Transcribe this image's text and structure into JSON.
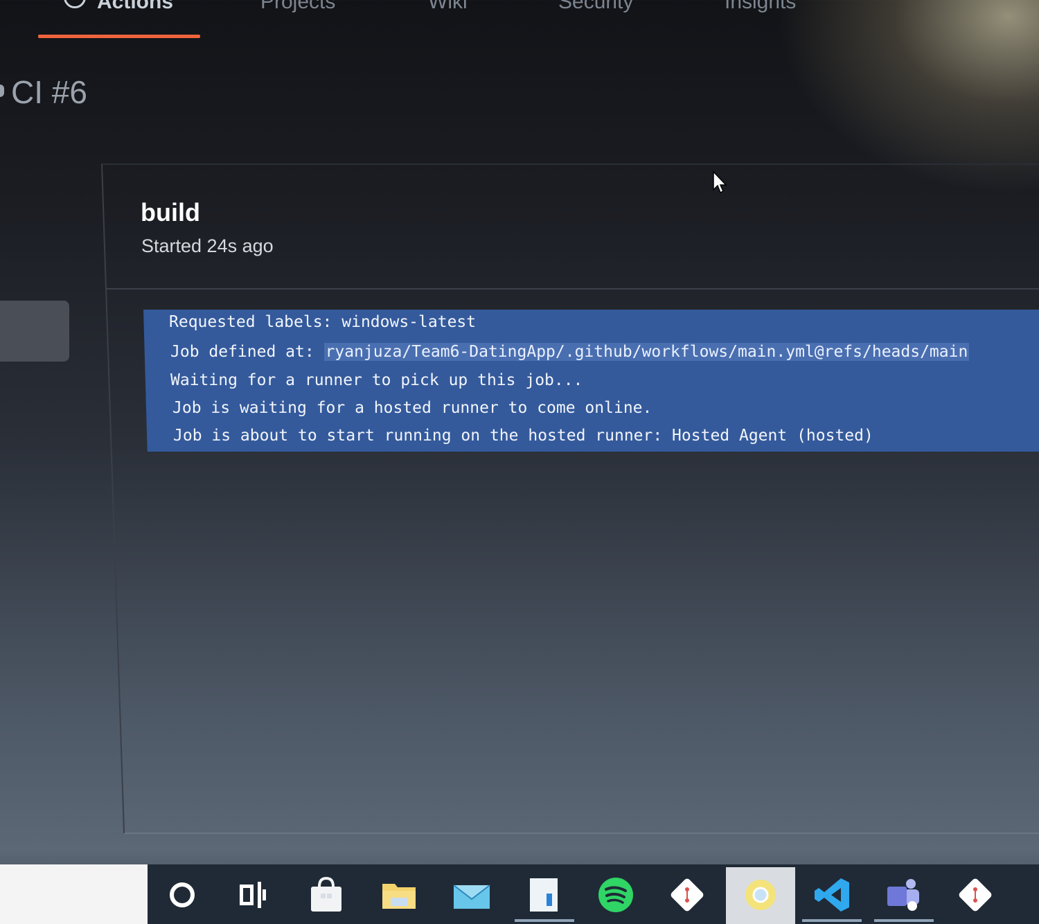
{
  "nav": {
    "tabs": [
      "Actions",
      "Projects",
      "Wiki",
      "Security",
      "Insights"
    ],
    "active_tab": "Actions",
    "accent_color": "#f0643c"
  },
  "run": {
    "title": "CI #6"
  },
  "job": {
    "name": "build",
    "status": "Started 24s ago",
    "log": {
      "line1": "Requested labels: windows-latest",
      "line2_prefix": "Job defined at: ",
      "line2_path": "ryanjuza/Team6-DatingApp/.github/workflows/main.yml@refs/heads/main",
      "line3": "Waiting for a runner to pick up this job...",
      "line4": "Job is waiting for a hosted runner to come online.",
      "line5": "Job is about to start running on the hosted runner: Hosted Agent (hosted)"
    },
    "selection_color": "#345a9c"
  },
  "taskbar": {
    "icons": [
      "cortana-icon",
      "task-view-icon",
      "store-icon",
      "file-explorer-icon",
      "mail-icon",
      "notepad-icon",
      "spotify-icon",
      "git-icon",
      "chrome-icon",
      "vscode-icon",
      "teams-icon",
      "git-bash-icon"
    ]
  }
}
